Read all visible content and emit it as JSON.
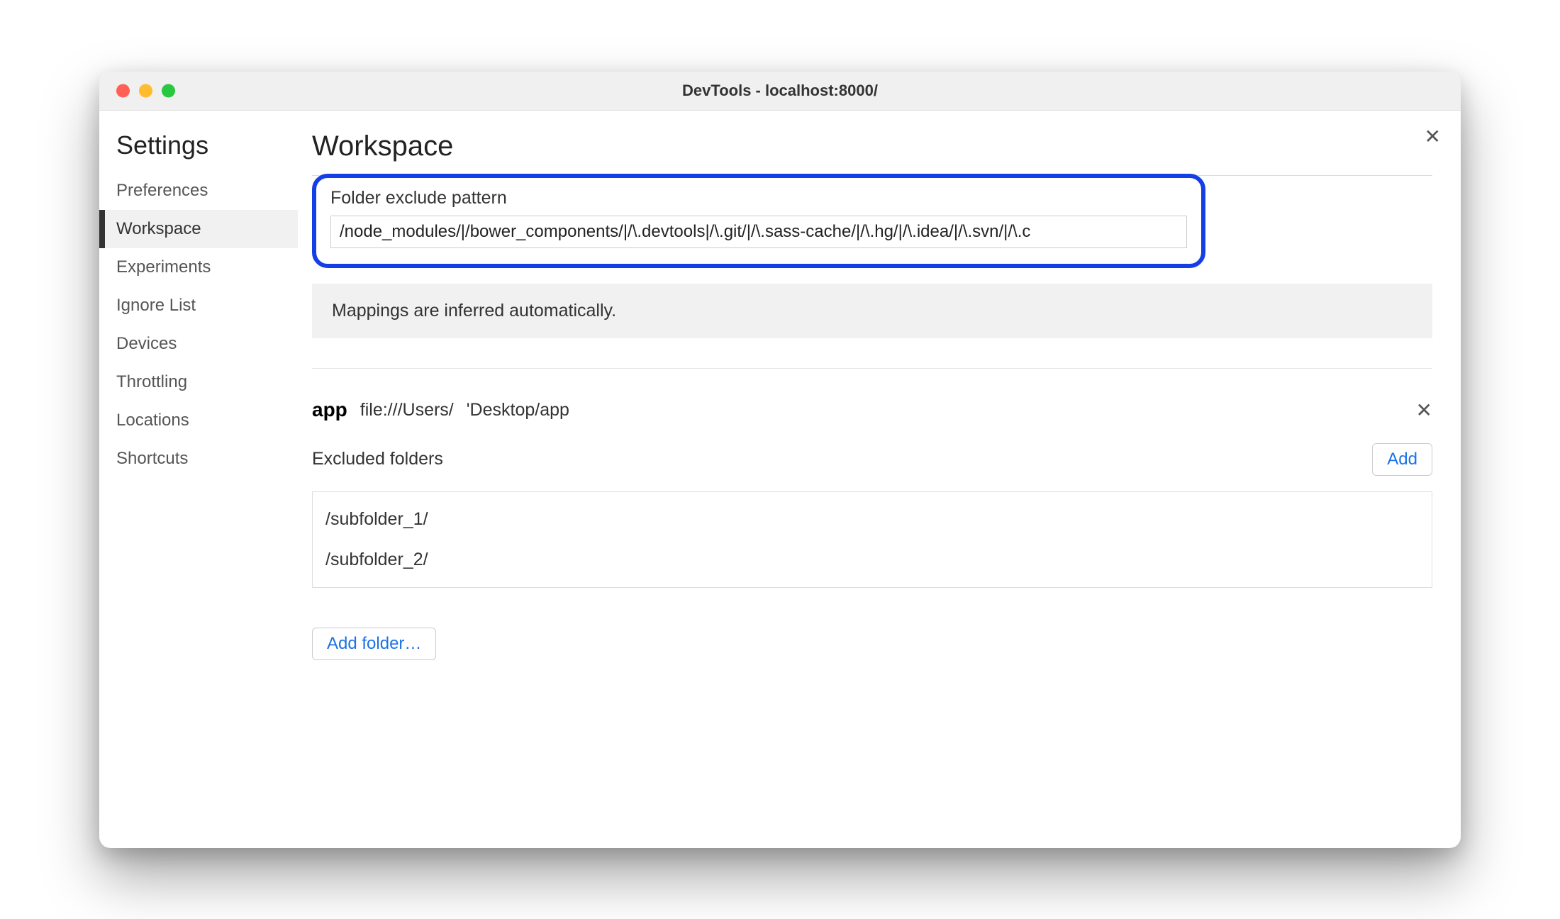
{
  "window": {
    "title": "DevTools - localhost:8000/"
  },
  "sidebar": {
    "heading": "Settings",
    "items": [
      {
        "label": "Preferences",
        "active": false
      },
      {
        "label": "Workspace",
        "active": true
      },
      {
        "label": "Experiments",
        "active": false
      },
      {
        "label": "Ignore List",
        "active": false
      },
      {
        "label": "Devices",
        "active": false
      },
      {
        "label": "Throttling",
        "active": false
      },
      {
        "label": "Locations",
        "active": false
      },
      {
        "label": "Shortcuts",
        "active": false
      }
    ]
  },
  "main": {
    "heading": "Workspace",
    "exclude_pattern_label": "Folder exclude pattern",
    "exclude_pattern_value": "/node_modules/|/bower_components/|/\\.devtools|/\\.git/|/\\.sass-cache/|/\\.hg/|/\\.idea/|/\\.svn/|/\\.c",
    "info_text": "Mappings are inferred automatically.",
    "folder": {
      "name": "app",
      "path_prefix": "file:///Users/",
      "path_suffix": "'Desktop/app"
    },
    "excluded_label": "Excluded folders",
    "add_button": "Add",
    "excluded_folders": [
      "/subfolder_1/",
      "/subfolder_2/"
    ],
    "add_folder_button": "Add folder…"
  },
  "icons": {
    "close_glyph": "✕"
  }
}
